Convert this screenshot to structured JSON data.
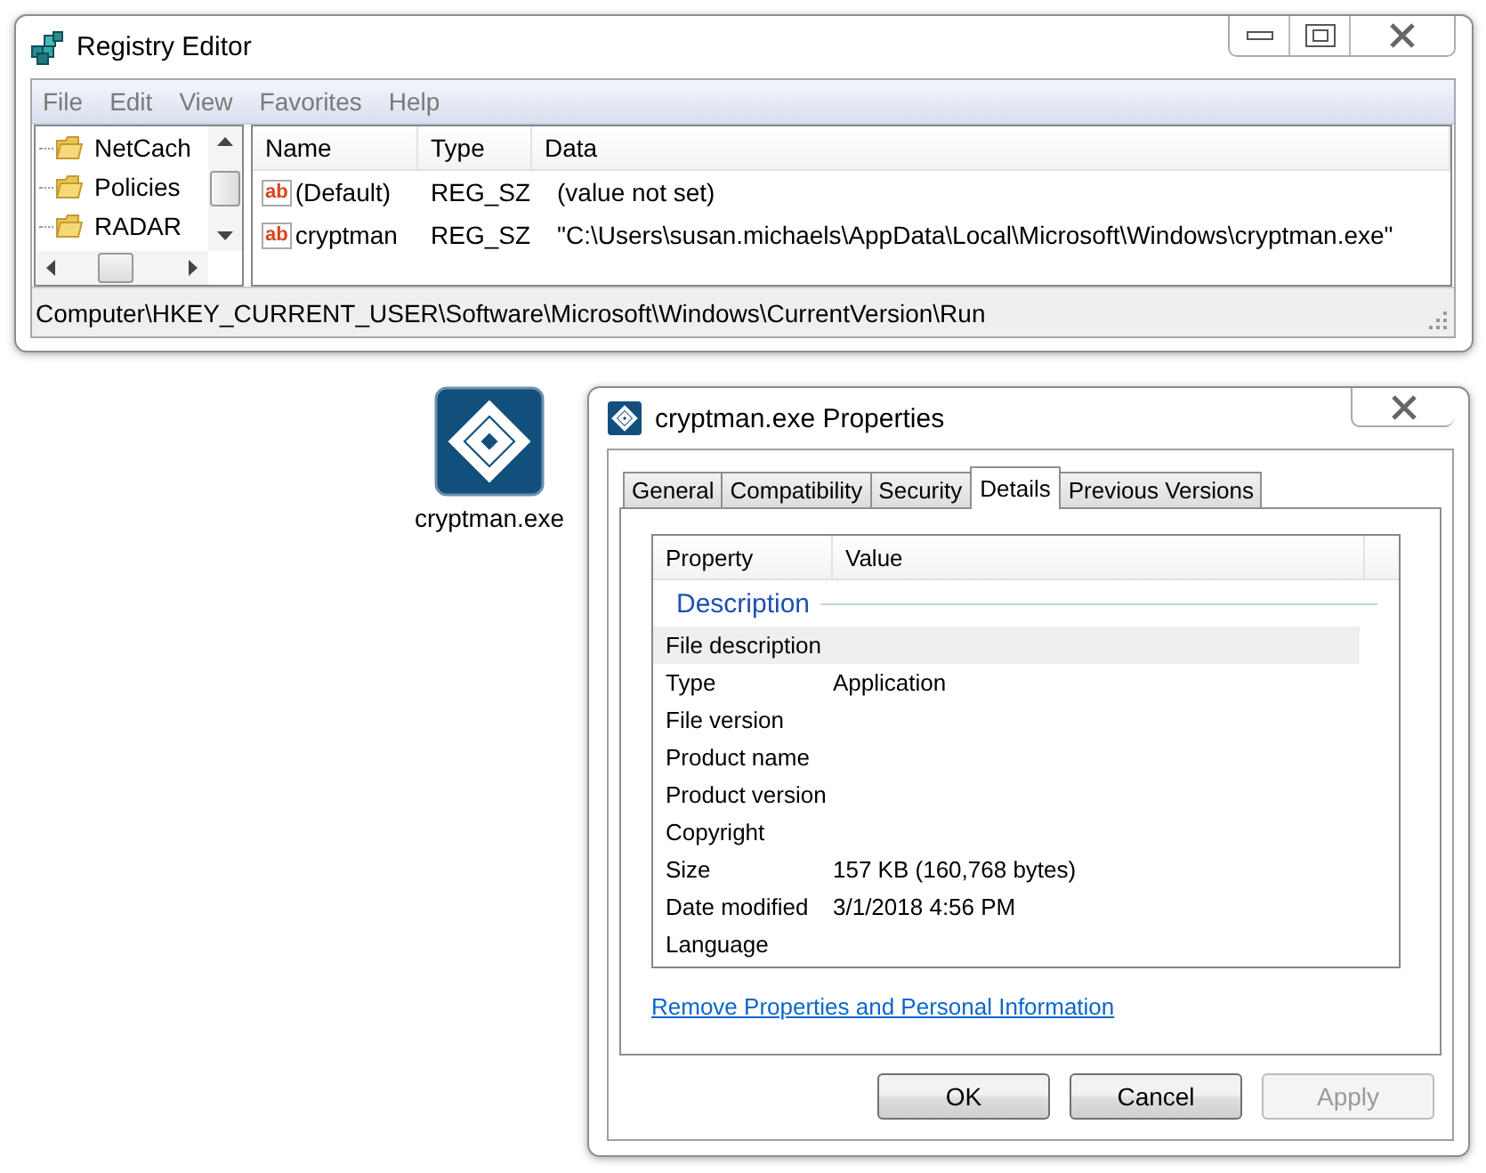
{
  "registry_window": {
    "title": "Registry Editor",
    "menu": [
      "File",
      "Edit",
      "View",
      "Favorites",
      "Help"
    ],
    "tree": [
      {
        "label": "NetCach"
      },
      {
        "label": "Policies"
      },
      {
        "label": "RADAR"
      }
    ],
    "columns": [
      "Name",
      "Type",
      "Data"
    ],
    "rows": [
      {
        "icon_label": "ab",
        "name": "(Default)",
        "type": "REG_SZ",
        "data": "(value not set)"
      },
      {
        "icon_label": "ab",
        "name": "cryptman",
        "type": "REG_SZ",
        "data": "\"C:\\Users\\susan.michaels\\AppData\\Local\\Microsoft\\Windows\\cryptman.exe\""
      }
    ],
    "status_bar": "Computer\\HKEY_CURRENT_USER\\Software\\Microsoft\\Windows\\CurrentVersion\\Run"
  },
  "desktop_icon": {
    "label": "cryptman.exe"
  },
  "properties_dialog": {
    "title": "cryptman.exe Properties",
    "tabs": [
      {
        "label": "General",
        "selected": false
      },
      {
        "label": "Compatibility",
        "selected": false
      },
      {
        "label": "Security",
        "selected": false
      },
      {
        "label": "Details",
        "selected": true
      },
      {
        "label": "Previous Versions",
        "selected": false
      }
    ],
    "columns": [
      "Property",
      "Value"
    ],
    "group": "Description",
    "rows": [
      {
        "property": "File description",
        "selected": true
      },
      {
        "property": "Type",
        "value": "Application",
        "selected": false
      },
      {
        "property": "File version",
        "selected": false
      },
      {
        "property": "Product name",
        "selected": false
      },
      {
        "property": "Product version",
        "selected": false
      },
      {
        "property": "Copyright",
        "selected": false
      },
      {
        "property": "Size",
        "value": "157 KB (160,768 bytes)",
        "selected": false
      },
      {
        "property": "Date modified",
        "value": "3/1/2018 4:56 PM",
        "selected": false
      },
      {
        "property": "Language",
        "selected": false
      }
    ],
    "link": "Remove Properties and Personal Information",
    "buttons": [
      {
        "label": "OK",
        "disabled": false
      },
      {
        "label": "Cancel",
        "disabled": false
      },
      {
        "label": "Apply",
        "disabled": true
      }
    ]
  }
}
